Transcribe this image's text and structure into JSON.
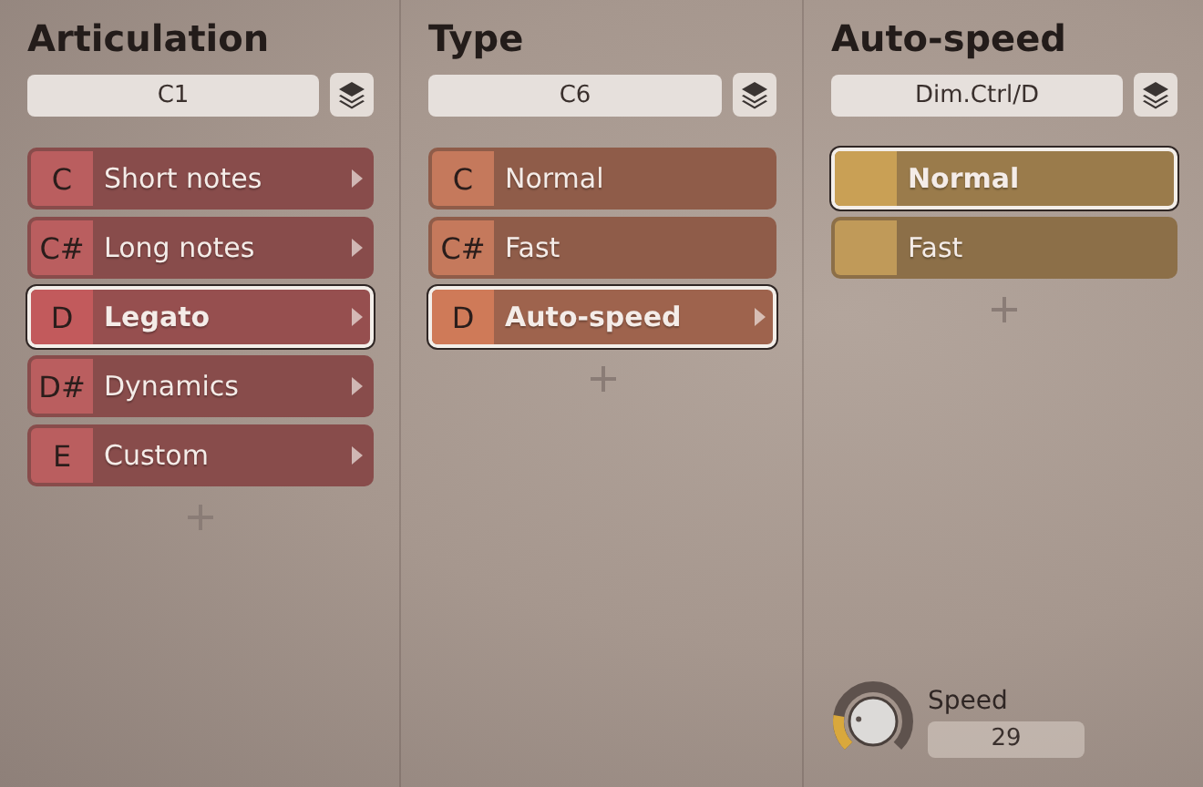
{
  "columns": [
    {
      "title": "Articulation",
      "field": "C1",
      "color": "#c25a5c",
      "items": [
        {
          "key": "C",
          "label": "Short notes",
          "has_arrow": true,
          "selected": false
        },
        {
          "key": "C#",
          "label": "Long notes",
          "has_arrow": true,
          "selected": false
        },
        {
          "key": "D",
          "label": "Legato",
          "has_arrow": true,
          "selected": true
        },
        {
          "key": "D#",
          "label": "Dynamics",
          "has_arrow": true,
          "selected": false
        },
        {
          "key": "E",
          "label": "Custom",
          "has_arrow": true,
          "selected": false
        }
      ]
    },
    {
      "title": "Type",
      "field": "C6",
      "color": "#cf7a58",
      "items": [
        {
          "key": "C",
          "label": "Normal",
          "has_arrow": false,
          "selected": false
        },
        {
          "key": "C#",
          "label": "Fast",
          "has_arrow": false,
          "selected": false
        },
        {
          "key": "D",
          "label": "Auto-speed",
          "has_arrow": true,
          "selected": true
        }
      ]
    },
    {
      "title": "Auto-speed",
      "field": "Dim.Ctrl/D",
      "color": "#c9a055",
      "items": [
        {
          "label": "Normal",
          "has_arrow": false,
          "selected": true
        },
        {
          "label": "Fast",
          "has_arrow": false,
          "selected": false
        }
      ],
      "knob": {
        "label": "Speed",
        "value": "29"
      }
    }
  ]
}
